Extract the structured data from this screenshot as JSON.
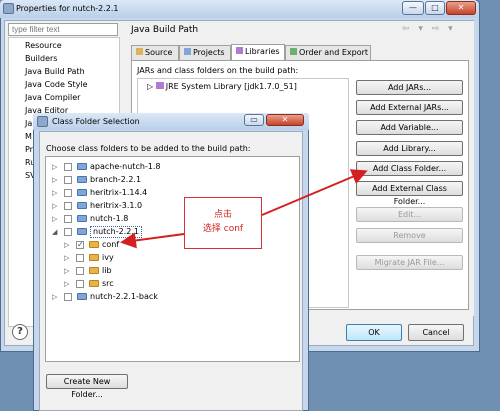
{
  "window": {
    "title": "Properties for nutch-2.2.1",
    "min": "—",
    "max": "□",
    "close": "✕",
    "filter_placeholder": "type filter text",
    "left_tree": [
      "Resource",
      "Builders",
      "Java Build Path",
      "Java Code Style",
      "Java Compiler",
      "Java Editor",
      "Ja",
      "M",
      "Pr",
      "Ru",
      "SV"
    ]
  },
  "build_path": {
    "title": "Java Build Path",
    "nav": "⇦ ▾ ⇨ ▾",
    "tabs": [
      "Source",
      "Projects",
      "Libraries",
      "Order and Export"
    ],
    "active_tab": "Libraries",
    "hint": "JARs and class folders on the build path:",
    "jre": "JRE System Library [jdk1.7.0_51]",
    "buttons": {
      "add_jars": "Add JARs...",
      "add_external_jars": "Add External JARs...",
      "add_variable": "Add Variable...",
      "add_library": "Add Library...",
      "add_class_folder": "Add Class Folder...",
      "add_external_class_folder": "Add External Class Folder...",
      "edit": "Edit...",
      "remove": "Remove",
      "migrate": "Migrate JAR File..."
    },
    "ok": "OK",
    "cancel": "Cancel",
    "help": "?"
  },
  "dialog": {
    "title": "Class Folder Selection",
    "close": "✕",
    "hint": "Choose class folders to be added to the build path:",
    "tree": [
      {
        "label": "apache-nutch-1.8",
        "level": 0,
        "checked": false,
        "kind": "project"
      },
      {
        "label": "branch-2.2.1",
        "level": 0,
        "checked": false,
        "kind": "project"
      },
      {
        "label": "heritrix-1.14.4",
        "level": 0,
        "checked": false,
        "kind": "project"
      },
      {
        "label": "heritrix-3.1.0",
        "level": 0,
        "checked": false,
        "kind": "project"
      },
      {
        "label": "nutch-1.8",
        "level": 0,
        "checked": false,
        "kind": "project"
      },
      {
        "label": "nutch-2.2.1",
        "level": 0,
        "checked": false,
        "kind": "project",
        "expanded": true
      },
      {
        "label": "conf",
        "level": 1,
        "checked": true,
        "kind": "folder"
      },
      {
        "label": "ivy",
        "level": 1,
        "checked": false,
        "kind": "folder"
      },
      {
        "label": "lib",
        "level": 1,
        "checked": false,
        "kind": "folder"
      },
      {
        "label": "src",
        "level": 1,
        "checked": false,
        "kind": "folder"
      },
      {
        "label": "nutch-2.2.1-back",
        "level": 0,
        "checked": false,
        "kind": "project"
      }
    ],
    "new_folder": "Create New Folder..."
  },
  "annotation": {
    "line1": "点击",
    "line2": "选择 conf",
    "color": "#d42020"
  }
}
